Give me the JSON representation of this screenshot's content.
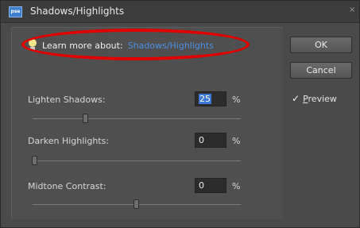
{
  "window": {
    "title": "Shadows/Highlights",
    "app_icon_text": "pse",
    "close_symbol": "×"
  },
  "learn_more": {
    "prefix": "Learn more about:",
    "link": "Shadows/Highlights",
    "icon": "lightbulb-icon"
  },
  "buttons": {
    "ok": "OK",
    "cancel": "Cancel"
  },
  "preview": {
    "check_symbol": "✓",
    "label_underlined": "P",
    "label_rest": "review",
    "checked": true
  },
  "sliders": [
    {
      "label": "Lighten Shadows:",
      "value": "25",
      "unit": "%",
      "position_fraction": 0.25,
      "selected": true
    },
    {
      "label": "Darken Highlights:",
      "value": "0",
      "unit": "%",
      "position_fraction": 0.0,
      "selected": false
    },
    {
      "label": "Midtone Contrast:",
      "value": "0",
      "unit": "%",
      "position_fraction": 0.5,
      "selected": false
    }
  ],
  "colors": {
    "dialog_bg": "#4a4a4a",
    "link": "#4a90e2",
    "highlight_ellipse": "#e00000",
    "selection": "#3e78d6"
  }
}
